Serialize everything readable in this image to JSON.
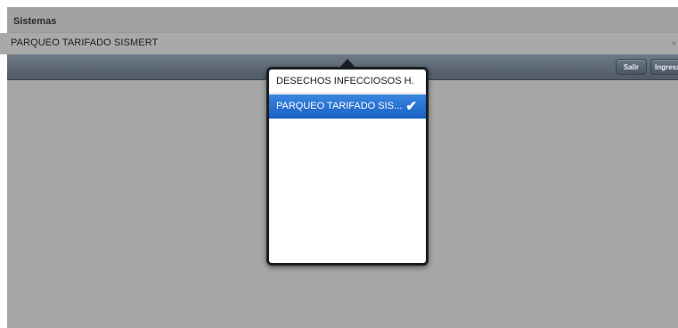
{
  "header": {
    "title": "Sistemas"
  },
  "select": {
    "value": "PARQUEO TARIFADO SISMERT",
    "arrow_icon": "chevron-down-icon"
  },
  "toolbar": {
    "salir_label": "Salir",
    "ingresar_label": "Ingresar"
  },
  "popover": {
    "options": [
      {
        "label": "DESECHOS INFECCIOSOS H.",
        "selected": false
      },
      {
        "label": "PARQUEO TARIFADO SIS...",
        "selected": true
      }
    ],
    "check_icon": "checkmark-icon"
  },
  "colors": {
    "background": "#a6a6a6",
    "toolbar": "#5a6571",
    "selected_option": "#2a73d6",
    "popover_border": "#1b1f24"
  }
}
